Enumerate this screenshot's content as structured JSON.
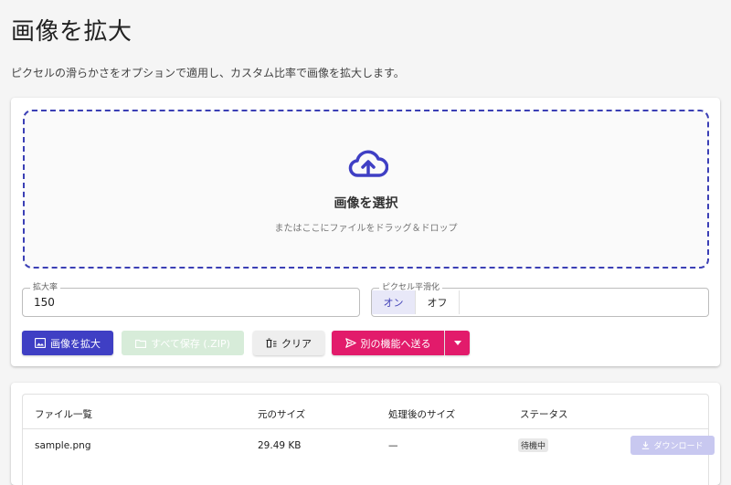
{
  "header": {
    "title": "画像を拡大",
    "subtitle": "ピクセルの滑らかさをオプションで適用し、カスタム比率で画像を拡大します。"
  },
  "dropzone": {
    "icon": "cloud-upload-icon",
    "title": "画像を選択",
    "hint": "またはここにファイルをドラッグ＆ドロップ"
  },
  "options": {
    "scale_label": "拡大率",
    "scale_value": "150",
    "smoothing_label": "ピクセル平滑化",
    "smoothing_on": "オン",
    "smoothing_off": "オフ",
    "smoothing_selected": "オン"
  },
  "actions": {
    "enlarge": "画像を拡大",
    "save_all": "すべて保存 (.ZIP)",
    "clear": "クリア",
    "send": "別の機能へ送る"
  },
  "file_list": {
    "columns": [
      "ファイル一覧",
      "元のサイズ",
      "処理後のサイズ",
      "ステータス"
    ],
    "rows": [
      {
        "name": "sample.png",
        "original_size": "29.49 KB",
        "processed_size": "—",
        "status": "待機中",
        "download": "ダウンロード"
      }
    ]
  },
  "colors": {
    "primary": "#3f3fc4",
    "accent": "#e21b6b",
    "save_disabled": "#d7ecd9",
    "download_disabled": "#c8c8f0"
  }
}
